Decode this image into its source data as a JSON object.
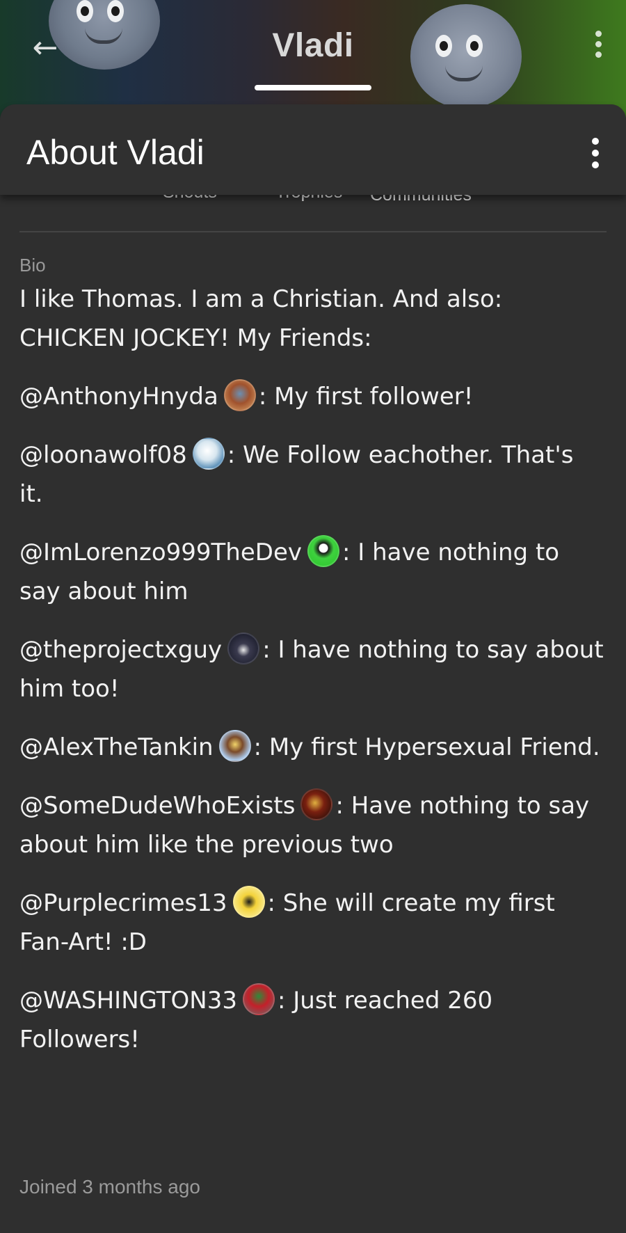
{
  "cover": {
    "title": "Vladi"
  },
  "about": {
    "title": "About Vladi"
  },
  "stats": {
    "tabs": [
      "Shouts",
      "Trophies",
      "Communities"
    ]
  },
  "bio": {
    "label": "Bio",
    "intro": "I like Thomas. I am a Christian. And also: CHICKEN JOCKEY! My Friends:",
    "friends": [
      {
        "handle": "@AnthonyHnyda",
        "note": ": My first follower!"
      },
      {
        "handle": "@loonawolf08",
        "note": ": We Follow eachother. That's it."
      },
      {
        "handle": "@ImLorenzo999TheDev",
        "note": ": I have nothing to say about him"
      },
      {
        "handle": "@theprojectxguy",
        "note": ": I have nothing to say about him too!"
      },
      {
        "handle": "@AlexTheTankin",
        "note": ": My first Hypersexual Friend."
      },
      {
        "handle": "@SomeDudeWhoExists",
        "note": ": Have nothing to say about him like the previous two"
      },
      {
        "handle": "@Purplecrimes13",
        "note": ": She will create my first Fan-Art! :D"
      },
      {
        "handle": "@WASHINGTON33",
        "note": ": Just reached 260 Followers!"
      }
    ]
  },
  "footer": {
    "joined": "Joined 3 months ago"
  },
  "icons": {
    "back": "arrow-left-icon",
    "more": "more-vertical-icon"
  },
  "colors": {
    "background": "#2f2f2f",
    "text": "#f2f2f2",
    "muted": "#9a9a9a"
  }
}
